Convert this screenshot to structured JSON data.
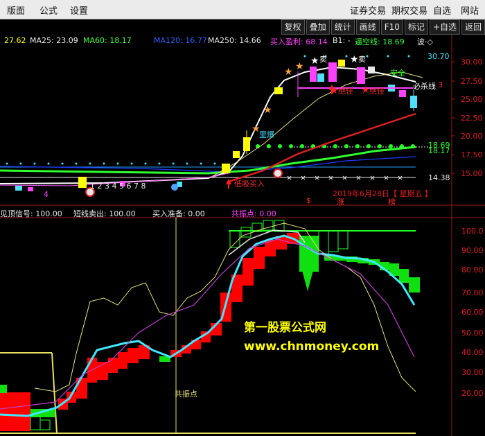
{
  "menu": {
    "left": [
      "版面",
      "公式",
      "设置"
    ],
    "right": [
      "证券交易",
      "期权交易",
      "自选",
      "网站"
    ]
  },
  "toolbar": [
    "复权",
    "叠加",
    "统计",
    "画线",
    "F10",
    "标记",
    "+自选",
    "返回"
  ],
  "ma_row": {
    "ma_cut": "27.62",
    "ma25": "MA25: 23.09",
    "ma60": "MA60: 18.17",
    "ma120": "MA120: 16.77",
    "ma250": "MA250: 14.66",
    "buy_profit": "买入盈利: 68.14",
    "b1": "B1: -",
    "short_line": "逼空线: 18.69",
    "wave": "波·◇"
  },
  "upper_axis": [
    "30.00",
    "27.50",
    "25.00",
    "22.50",
    "20.00",
    "17.50",
    "15.00"
  ],
  "upper_markers": {
    "high": "30.70",
    "level1": "18.69",
    "level2": "18.17",
    "low": "14.38"
  },
  "upper_annotations": {
    "sell": "卖",
    "strong_gain": "里爆",
    "peak_best1": "绝佳",
    "peak_best2": "绝佳",
    "must_kill": "必杀线",
    "sell2": "卖",
    "entrust": "安全",
    "cut_3": "3",
    "bottom_note": "低吸买入",
    "bottom_left": "4",
    "ticks": "1 2 3 4 5 6 7 8"
  },
  "date_label": "2019年6月28日【 星期五 】",
  "bottom_markers": [
    "$",
    "涨",
    "榜"
  ],
  "signal_row": {
    "peak": "见顶信号: 100.00",
    "short_sell": "短线卖出: 100.00",
    "buy_ready": "买入准备: 0.00",
    "resonance": "共振点: 0.00"
  },
  "lower_axis": [
    "100.0",
    "90.00",
    "80.00",
    "70.00",
    "60.00",
    "50.00",
    "40.00",
    "30.00",
    "20.00"
  ],
  "resonance_label": "共振点",
  "watermark": {
    "title": "第一股票公式网",
    "url": "www.chnmoney.com"
  },
  "chart_data": {
    "type": "candlestick",
    "date": "2019-06-28",
    "y_axis": [
      15.0,
      30.0
    ],
    "indicator_axis": [
      20,
      100
    ],
    "ma25_curve": [
      15.2,
      15.1,
      15.0,
      14.9,
      14.8,
      14.8,
      14.9,
      15.0,
      15.4,
      16.5,
      18.5,
      21.5,
      24.5,
      26.5,
      27.5,
      28.0,
      28.2,
      28.3
    ],
    "ma60_curve": [
      14.4,
      14.3,
      14.3,
      14.2,
      14.2,
      14.2,
      14.2,
      14.3,
      14.4,
      14.8,
      15.5,
      16.5,
      17.8,
      19.2,
      20.5,
      21.8,
      22.8,
      23.4
    ],
    "indicator_line": [
      20,
      22,
      25,
      30,
      38,
      45,
      46,
      44,
      43,
      41,
      38,
      48,
      60,
      75,
      88,
      96,
      100,
      92,
      85,
      78,
      70,
      65
    ]
  }
}
